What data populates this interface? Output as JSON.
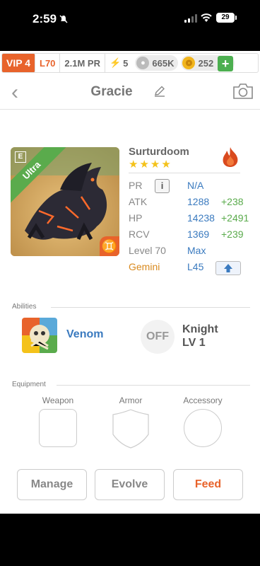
{
  "status_bar": {
    "time": "2:59",
    "battery": "29"
  },
  "top_bar": {
    "vip": "VIP 4",
    "level": "L70",
    "power": "2.1M PR",
    "energy": "5",
    "food": "665K",
    "gold": "252",
    "add_label": "+"
  },
  "header": {
    "back": "‹",
    "name": "Gracie"
  },
  "creature": {
    "name": "Surturdoom",
    "rarity_badge": "Ultra",
    "element_tag": "E",
    "stars": [
      "★",
      "★",
      "★",
      "★"
    ],
    "stats": {
      "pr_label": "PR",
      "pr_info": "i",
      "pr_value": "N/A",
      "atk_label": "ATK",
      "atk_value": "1288",
      "atk_bonus": "+238",
      "hp_label": "HP",
      "hp_value": "14238",
      "hp_bonus": "+2491",
      "rcv_label": "RCV",
      "rcv_value": "1369",
      "rcv_bonus": "+239",
      "level_label": "Level 70",
      "level_value": "Max",
      "sign_label": "Gemini",
      "sign_value": "L45"
    }
  },
  "abilities": {
    "title": "Abilities",
    "ability_name": "Venom",
    "off_label": "OFF",
    "knight_name": "Knight",
    "knight_level": "LV 1"
  },
  "equipment": {
    "title": "Equipment",
    "slots": [
      "Weapon",
      "Armor",
      "Accessory"
    ]
  },
  "actions": {
    "manage": "Manage",
    "evolve": "Evolve",
    "feed": "Feed"
  },
  "colors": {
    "accent": "#e8632b",
    "blue": "#3a7abf",
    "green": "#5aab4c",
    "star": "#f4c21a"
  }
}
